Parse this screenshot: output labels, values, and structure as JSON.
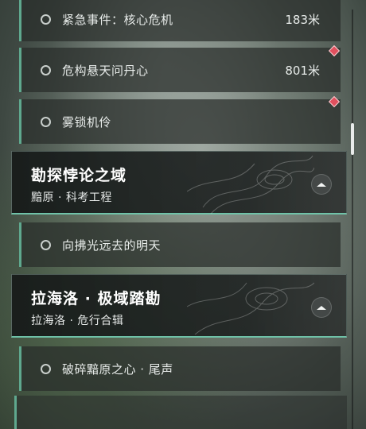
{
  "tasks": [
    {
      "label": "紧急事件：核心危机",
      "distance": "183米"
    },
    {
      "label": "危构悬天问丹心",
      "distance": "801米"
    },
    {
      "label": "雾锁机伶",
      "distance": ""
    },
    {
      "label": "向拂光远去的明天",
      "distance": ""
    },
    {
      "label": "破碎黯原之心 · 尾声",
      "distance": ""
    }
  ],
  "chapters": [
    {
      "title": "勘探悖论之域",
      "subtitle": "黯原 · 科考工程"
    },
    {
      "title": "拉海洛 · 极域踏勘",
      "subtitle": "拉海洛 · 危行合辑"
    }
  ],
  "icons": {
    "task_status": "circle-outline-icon",
    "marker": "red-diamond-marker-icon",
    "collapse": "collapse-up-arrow-icon"
  },
  "colors": {
    "accent": "#6fc2a8",
    "marker": "#e0505e"
  }
}
